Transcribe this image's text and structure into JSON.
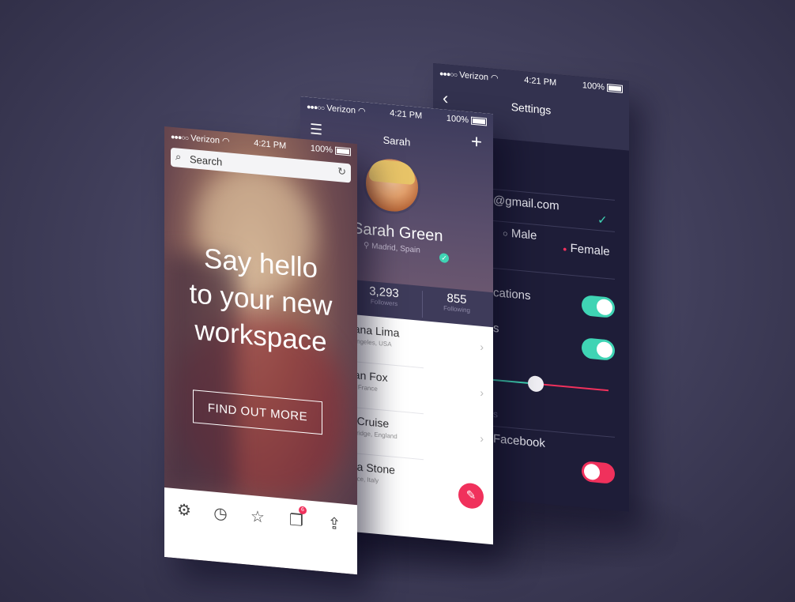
{
  "status": {
    "carrier": "Verizon",
    "time": "4:21 PM",
    "battery": "100%"
  },
  "settings": {
    "title": "Settings",
    "email_section_fragment": "n",
    "email": "@gmail.com",
    "gender_options": [
      "Male",
      "Female"
    ],
    "gender_selected": "Female",
    "notifications_fragment": "cations",
    "second_toggle_fragment": "s",
    "slider_value": 0.35,
    "accounts_section_fragment": "s",
    "facebook_label": "Facebook",
    "toggles": [
      true,
      true,
      false
    ],
    "accent_on": "#3fd4b4",
    "accent_off": "#f0315c"
  },
  "profile": {
    "header_name": "Sarah",
    "full_name": "Sarah Green",
    "location": "Madrid, Spain",
    "stats": [
      {
        "value": "3,293",
        "label": "Followers"
      },
      {
        "value": "855",
        "label": "Following"
      }
    ],
    "people": [
      {
        "name": "riana Lima",
        "city": "s Angeles, USA"
      },
      {
        "name": "gan Fox",
        "city": "ris, France"
      },
      {
        "name": "n Cruise",
        "city": "mbridge, England"
      },
      {
        "name": "ma Stone",
        "city": "rence, Italy"
      }
    ]
  },
  "workspace": {
    "search_placeholder": "Search",
    "headline_line1": "Say hello",
    "headline_line2": "to your new",
    "headline_line3": "workspace",
    "cta_label": "FIND OUT MORE",
    "tabs": [
      "gear-icon",
      "history-icon",
      "star-icon",
      "copy-icon",
      "share-icon"
    ],
    "copy_badge": "6"
  }
}
